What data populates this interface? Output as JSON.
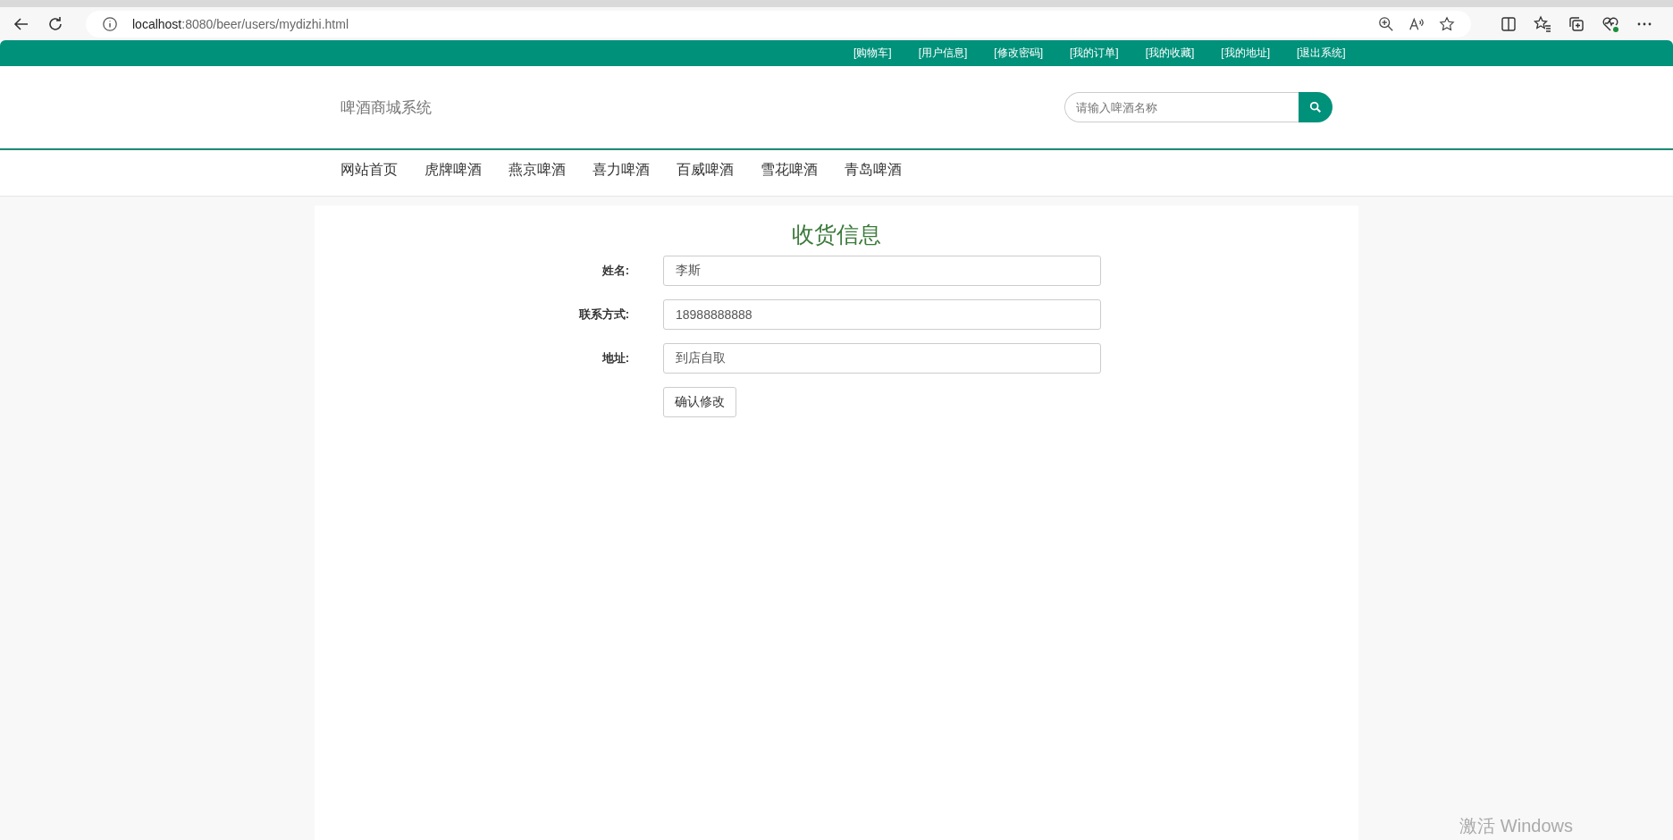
{
  "browser": {
    "url_host": "localhost",
    "url_path": ":8080/beer/users/mydizhi.html"
  },
  "top_links": [
    "[购物车]",
    "[用户信息]",
    "[修改密码]",
    "[我的订单]",
    "[我的收藏]",
    "[我的地址]",
    "[退出系统]"
  ],
  "header": {
    "logo": "啤酒商城系统",
    "search": {
      "placeholder": "请输入啤酒名称"
    }
  },
  "nav": [
    "网站首页",
    "虎牌啤酒",
    "燕京啤酒",
    "喜力啤酒",
    "百威啤酒",
    "雪花啤酒",
    "青岛啤酒"
  ],
  "form": {
    "title": "收货信息",
    "fields": [
      {
        "label": "姓名:",
        "value": "李斯"
      },
      {
        "label": "联系方式:",
        "value": "18988888888"
      },
      {
        "label": "地址:",
        "value": "到店自取"
      }
    ],
    "submit": "确认修改"
  },
  "os_watermark": "激活 Windows"
}
